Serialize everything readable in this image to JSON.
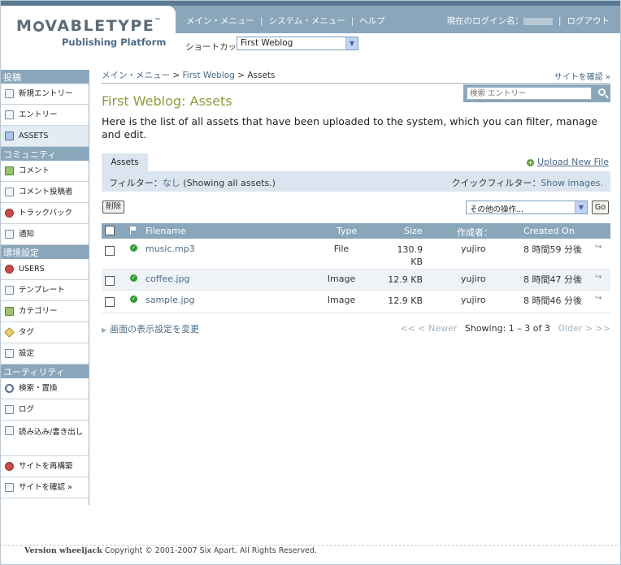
{
  "header": {
    "logo_text": "MOVABLETYPE",
    "logo_sub": "Publishing Platform",
    "nav": [
      "メイン・メニュー",
      "システム・メニュー",
      "ヘルプ"
    ],
    "login_label": "現在のログイン名：",
    "logout": "ログアウト",
    "shortcut_label": "ショートカット：",
    "shortcut_value": "First Weblog"
  },
  "sidebar": {
    "sections": [
      {
        "title": "投稿",
        "items": [
          "新規エントリー",
          "エントリー",
          "ASSETS"
        ]
      },
      {
        "title": "コミュニティ",
        "items": [
          "コメント",
          "コメント投稿者",
          "トラックバック",
          "通知"
        ]
      },
      {
        "title": "環境設定",
        "items": [
          "USERS",
          "テンプレート",
          "カテゴリー",
          "タグ",
          "設定"
        ]
      },
      {
        "title": "ユーティリティ",
        "items": [
          "検索・置換",
          "ログ",
          "読み込み/書き出し",
          "サイトを再構築",
          "サイトを確認 »"
        ]
      }
    ],
    "active": "ASSETS"
  },
  "breadcrumb": {
    "home": "メイン・メニュー",
    "sep": ">",
    "blog": "First Weblog",
    "current": "Assets"
  },
  "view_site": "サイトを確認 »",
  "search": {
    "placeholder": "検索 エントリー"
  },
  "title": "First Weblog: Assets",
  "description": "Here is the list of all assets that have been uploaded to the system, which you can filter, manage and edit.",
  "tab": "Assets",
  "upload_link": "Upload New File",
  "filter": {
    "label": "フィルター：",
    "value": "なし",
    "note": "(Showing all assets.)",
    "quick_label": "クイックフィルター：",
    "quick_value": "Show images."
  },
  "actions": {
    "delete": "削除",
    "more": "その他の操作...",
    "go": "Go"
  },
  "table": {
    "headers": {
      "filename": "Filename",
      "type": "Type",
      "size": "Size",
      "author": "作成者：",
      "created": "Created On"
    },
    "rows": [
      {
        "filename": "music.mp3",
        "type": "File",
        "size_line1": "130.9",
        "size_line2": "KB",
        "author": "yujiro",
        "created": "8 時間59 分後"
      },
      {
        "filename": "coffee.jpg",
        "type": "Image",
        "size_line1": "12.9 KB",
        "size_line2": "",
        "author": "yujiro",
        "created": "8 時間47 分後"
      },
      {
        "filename": "sample.jpg",
        "type": "Image",
        "size_line1": "12.9 KB",
        "size_line2": "",
        "author": "yujiro",
        "created": "8 時間46 分後"
      }
    ]
  },
  "table_footer": {
    "display_settings": "画面の表示設定を変更",
    "first": "<<",
    "prev": "< Newer",
    "showing": "Showing: 1 – 3 of 3",
    "next": "Older >",
    "last": ">>"
  },
  "footer": {
    "version": "Version wheeljack",
    "copyright": "Copyright © 2001-2007 Six Apart. All Rights Reserved."
  },
  "colors": {
    "header": "#8aa6bb",
    "title": "#8a9e3c",
    "link": "#4b6a88"
  }
}
